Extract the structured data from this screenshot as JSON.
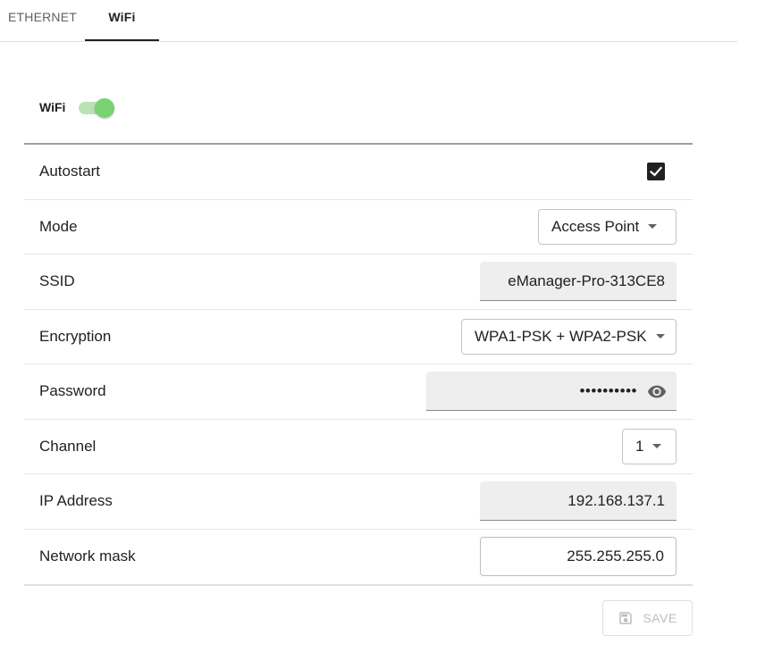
{
  "tabs": [
    {
      "label": "ETHERNET",
      "active": false
    },
    {
      "label": "WiFi",
      "active": true
    }
  ],
  "wifi": {
    "toggle_label": "WiFi",
    "enabled": true,
    "accent_color": "#7bd272"
  },
  "fields": {
    "autostart": {
      "label": "Autostart",
      "checked": true
    },
    "mode": {
      "label": "Mode",
      "value": "Access Point"
    },
    "ssid": {
      "label": "SSID",
      "value": "eManager-Pro-313CE8"
    },
    "encryption": {
      "label": "Encryption",
      "value": "WPA1-PSK + WPA2-PSK"
    },
    "password": {
      "label": "Password",
      "masked_value": "••••••••••",
      "icon": "eye-icon"
    },
    "channel": {
      "label": "Channel",
      "value": "1"
    },
    "ip_address": {
      "label": "IP Address",
      "value": "192.168.137.1"
    },
    "network_mask": {
      "label": "Network mask",
      "value": "255.255.255.0"
    }
  },
  "actions": {
    "save_label": "SAVE",
    "save_icon": "floppy-disk-icon",
    "save_enabled": false
  }
}
